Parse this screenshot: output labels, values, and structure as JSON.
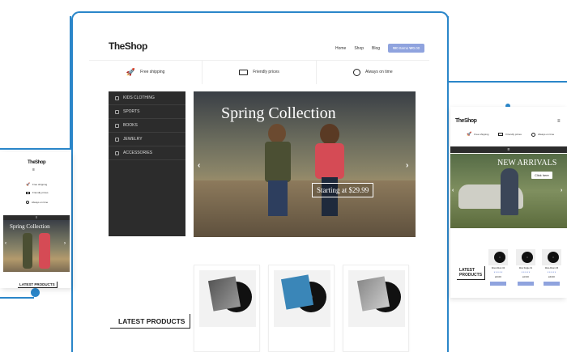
{
  "colors": {
    "accent": "#2a86c9",
    "cart": "#8fa3de",
    "menu": "#2c2c2c"
  },
  "desktop": {
    "logo": "TheShop",
    "nav": [
      "Home",
      "Shop",
      "Blog"
    ],
    "cart_label": "₩0 Items ₩0.00",
    "features": [
      {
        "icon": "rocket-icon",
        "label": "Free shipping"
      },
      {
        "icon": "money-icon",
        "label": "Friendly prices"
      },
      {
        "icon": "clock-icon",
        "label": "Always on time"
      }
    ],
    "categories": [
      {
        "icon": "shirt-icon",
        "label": "Kids clothing"
      },
      {
        "icon": "sports-icon",
        "label": "Sports"
      },
      {
        "icon": "book-icon",
        "label": "Books"
      },
      {
        "icon": "jewelry-icon",
        "label": "Jewelry"
      },
      {
        "icon": "bag-icon",
        "label": "Accessories"
      }
    ],
    "slide_title": "Spring Collection",
    "slide_button": "Starting at $29.99",
    "latest_title": "LATEST PRODUCTS"
  },
  "tablet": {
    "logo": "TheShop",
    "features": [
      {
        "icon": "rocket-icon",
        "label": "Free shipping"
      },
      {
        "icon": "money-icon",
        "label": "Friendly prices"
      },
      {
        "icon": "clock-icon",
        "label": "Always on time"
      }
    ],
    "slide_title": "NEW ARRIVALS",
    "slide_button": "Click here",
    "latest_title_1": "LATEST",
    "latest_title_2": "PRODUCTS",
    "products": [
      {
        "name": "Woo Album #4",
        "price": "£9.00"
      },
      {
        "name": "Woo Single #1",
        "price": "£3.00"
      },
      {
        "name": "Woo Album #3",
        "price": "£9.00"
      }
    ]
  },
  "mobile": {
    "logo": "TheShop",
    "features": [
      {
        "icon": "rocket-icon",
        "label": "Free shipping"
      },
      {
        "icon": "money-icon",
        "label": "Friendly prices"
      },
      {
        "icon": "clock-icon",
        "label": "Always on time"
      }
    ],
    "slide_title": "Spring Collection",
    "latest_title": "LATEST PRODUCTS"
  }
}
